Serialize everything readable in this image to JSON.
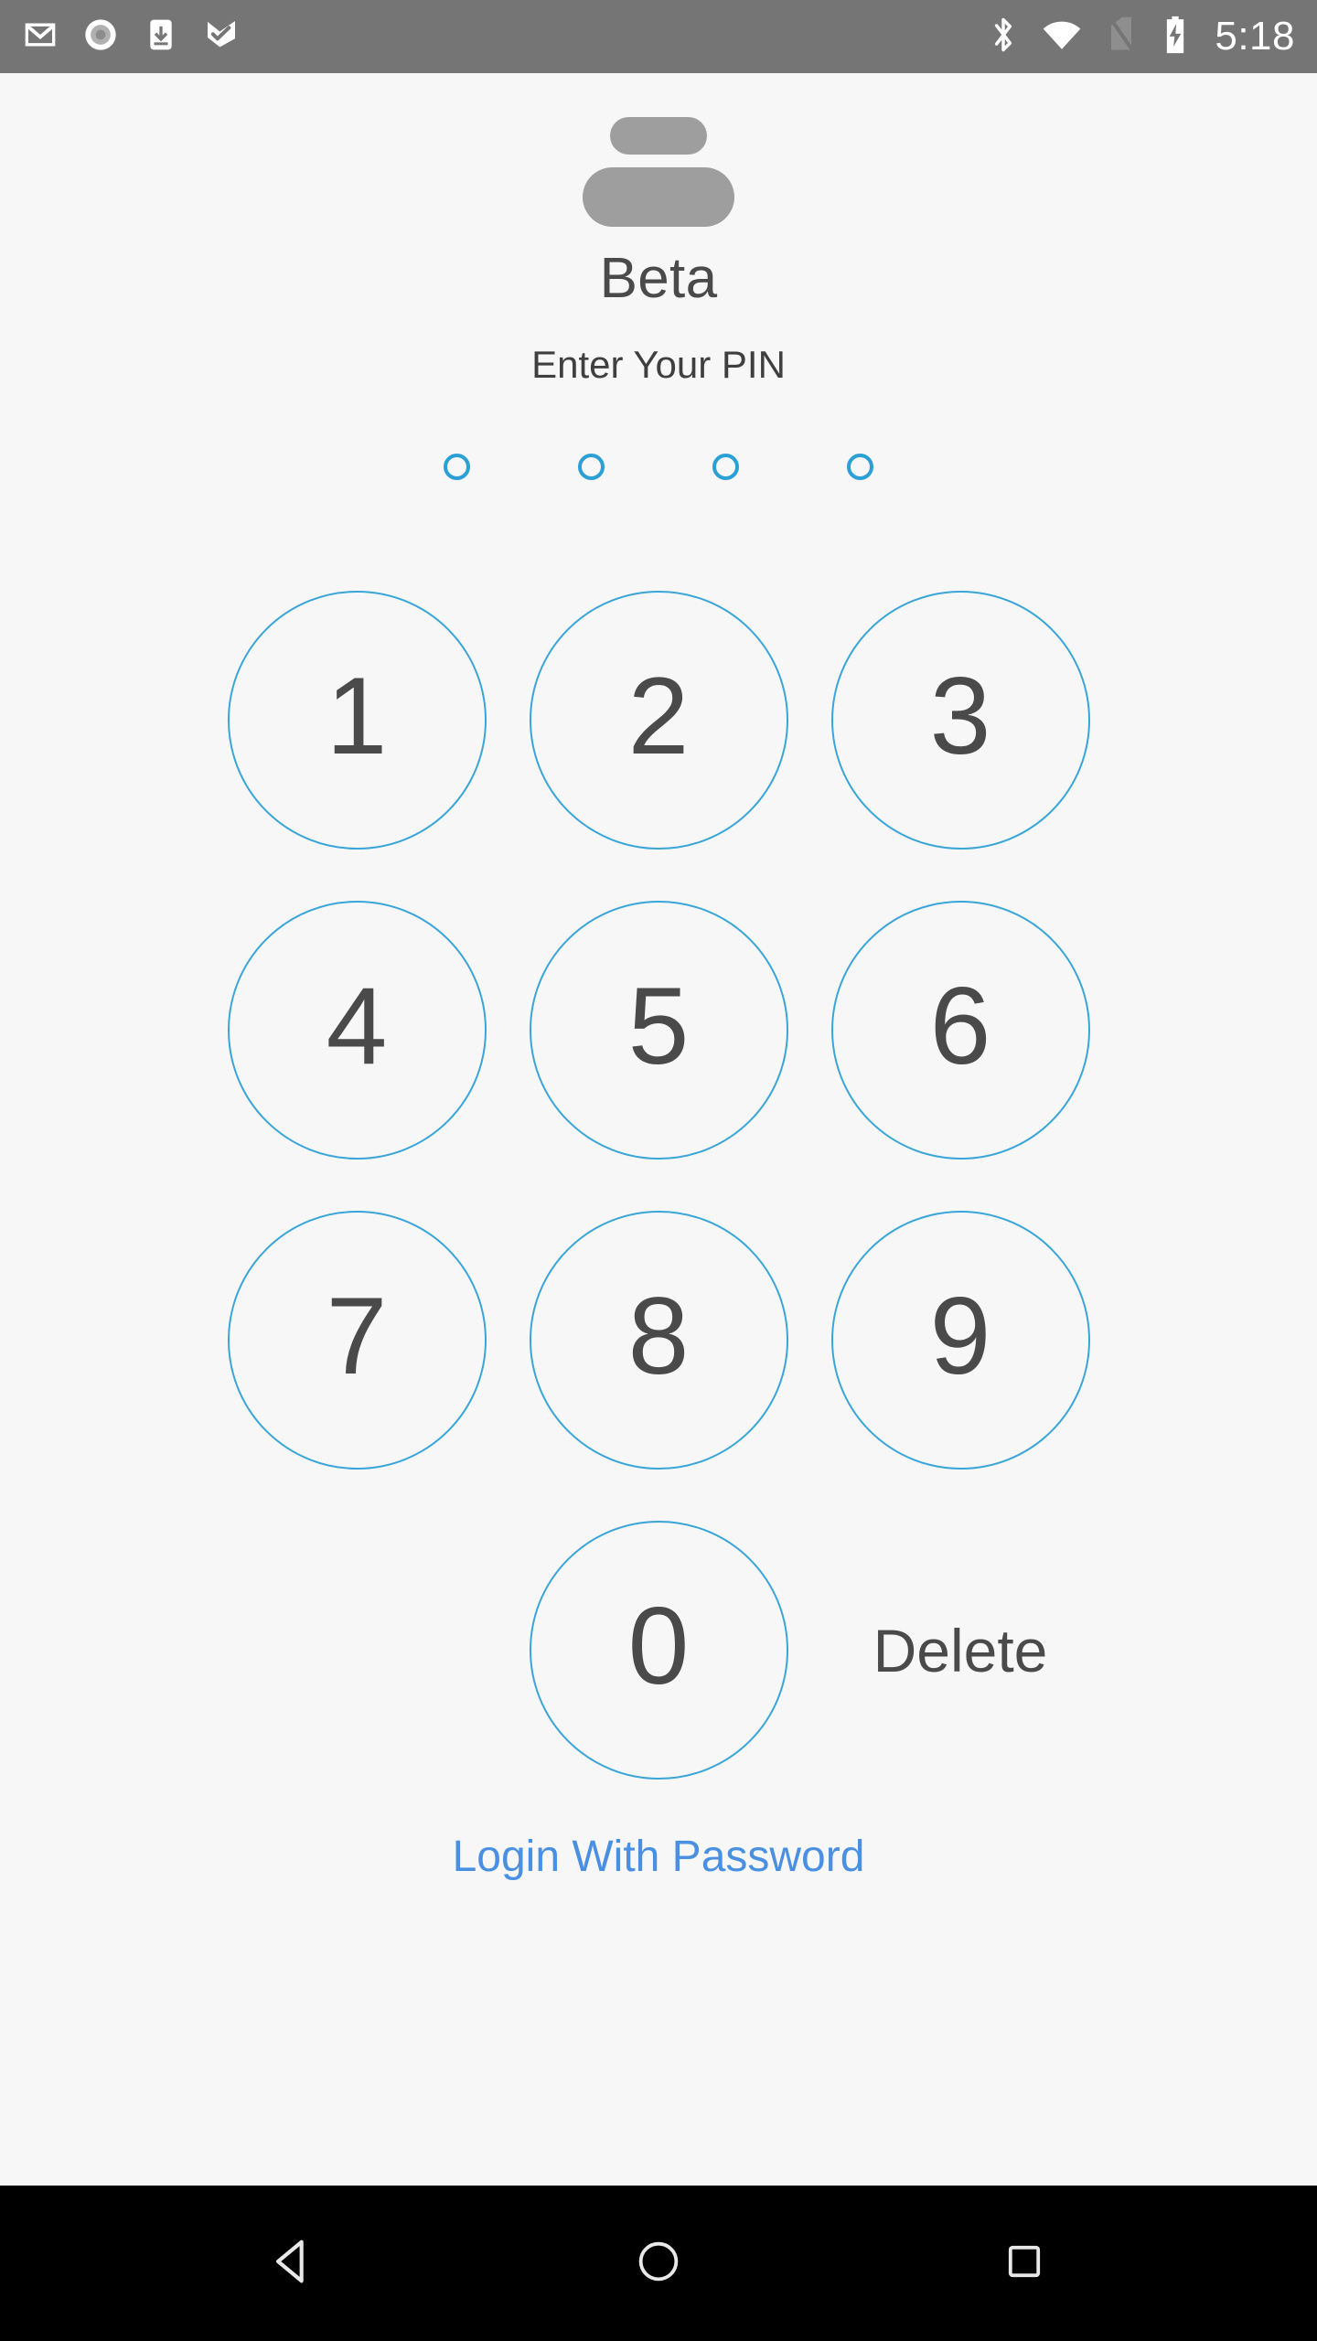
{
  "status_bar": {
    "background_color": "#757575",
    "time": "5:18",
    "left_icons": [
      {
        "name": "gmail-icon",
        "label": "Gmail"
      },
      {
        "name": "record-icon",
        "label": "Screen recorder"
      },
      {
        "name": "download-icon",
        "label": "Download"
      },
      {
        "name": "tasks-check-icon",
        "label": "Tasks"
      }
    ],
    "right_icons": [
      {
        "name": "bluetooth-icon",
        "label": "Bluetooth"
      },
      {
        "name": "wifi-icon",
        "label": "Wi-Fi"
      },
      {
        "name": "no-sim-icon",
        "label": "No SIM"
      },
      {
        "name": "battery-charging-icon",
        "label": "Battery charging"
      }
    ]
  },
  "app": {
    "title": "Beta",
    "prompt": "Enter Your PIN",
    "logo_color": "#9e9e9e",
    "accent_color": "#2ba0d6",
    "link_color": "#4a90e2",
    "text_color": "#4a4a4a",
    "background_color": "#f7f7f7"
  },
  "pin": {
    "length": 4,
    "entered": 0,
    "dots": [
      "empty",
      "empty",
      "empty",
      "empty"
    ]
  },
  "keypad": {
    "keys": [
      "1",
      "2",
      "3",
      "4",
      "5",
      "6",
      "7",
      "8",
      "9"
    ],
    "zero_key": "0",
    "delete_label": "Delete"
  },
  "footer": {
    "login_with_password": "Login With Password"
  },
  "nav_bar": {
    "background_color": "#000000",
    "buttons": [
      {
        "name": "back-button",
        "label": "Back"
      },
      {
        "name": "home-button",
        "label": "Home"
      },
      {
        "name": "recents-button",
        "label": "Recent apps"
      }
    ]
  }
}
